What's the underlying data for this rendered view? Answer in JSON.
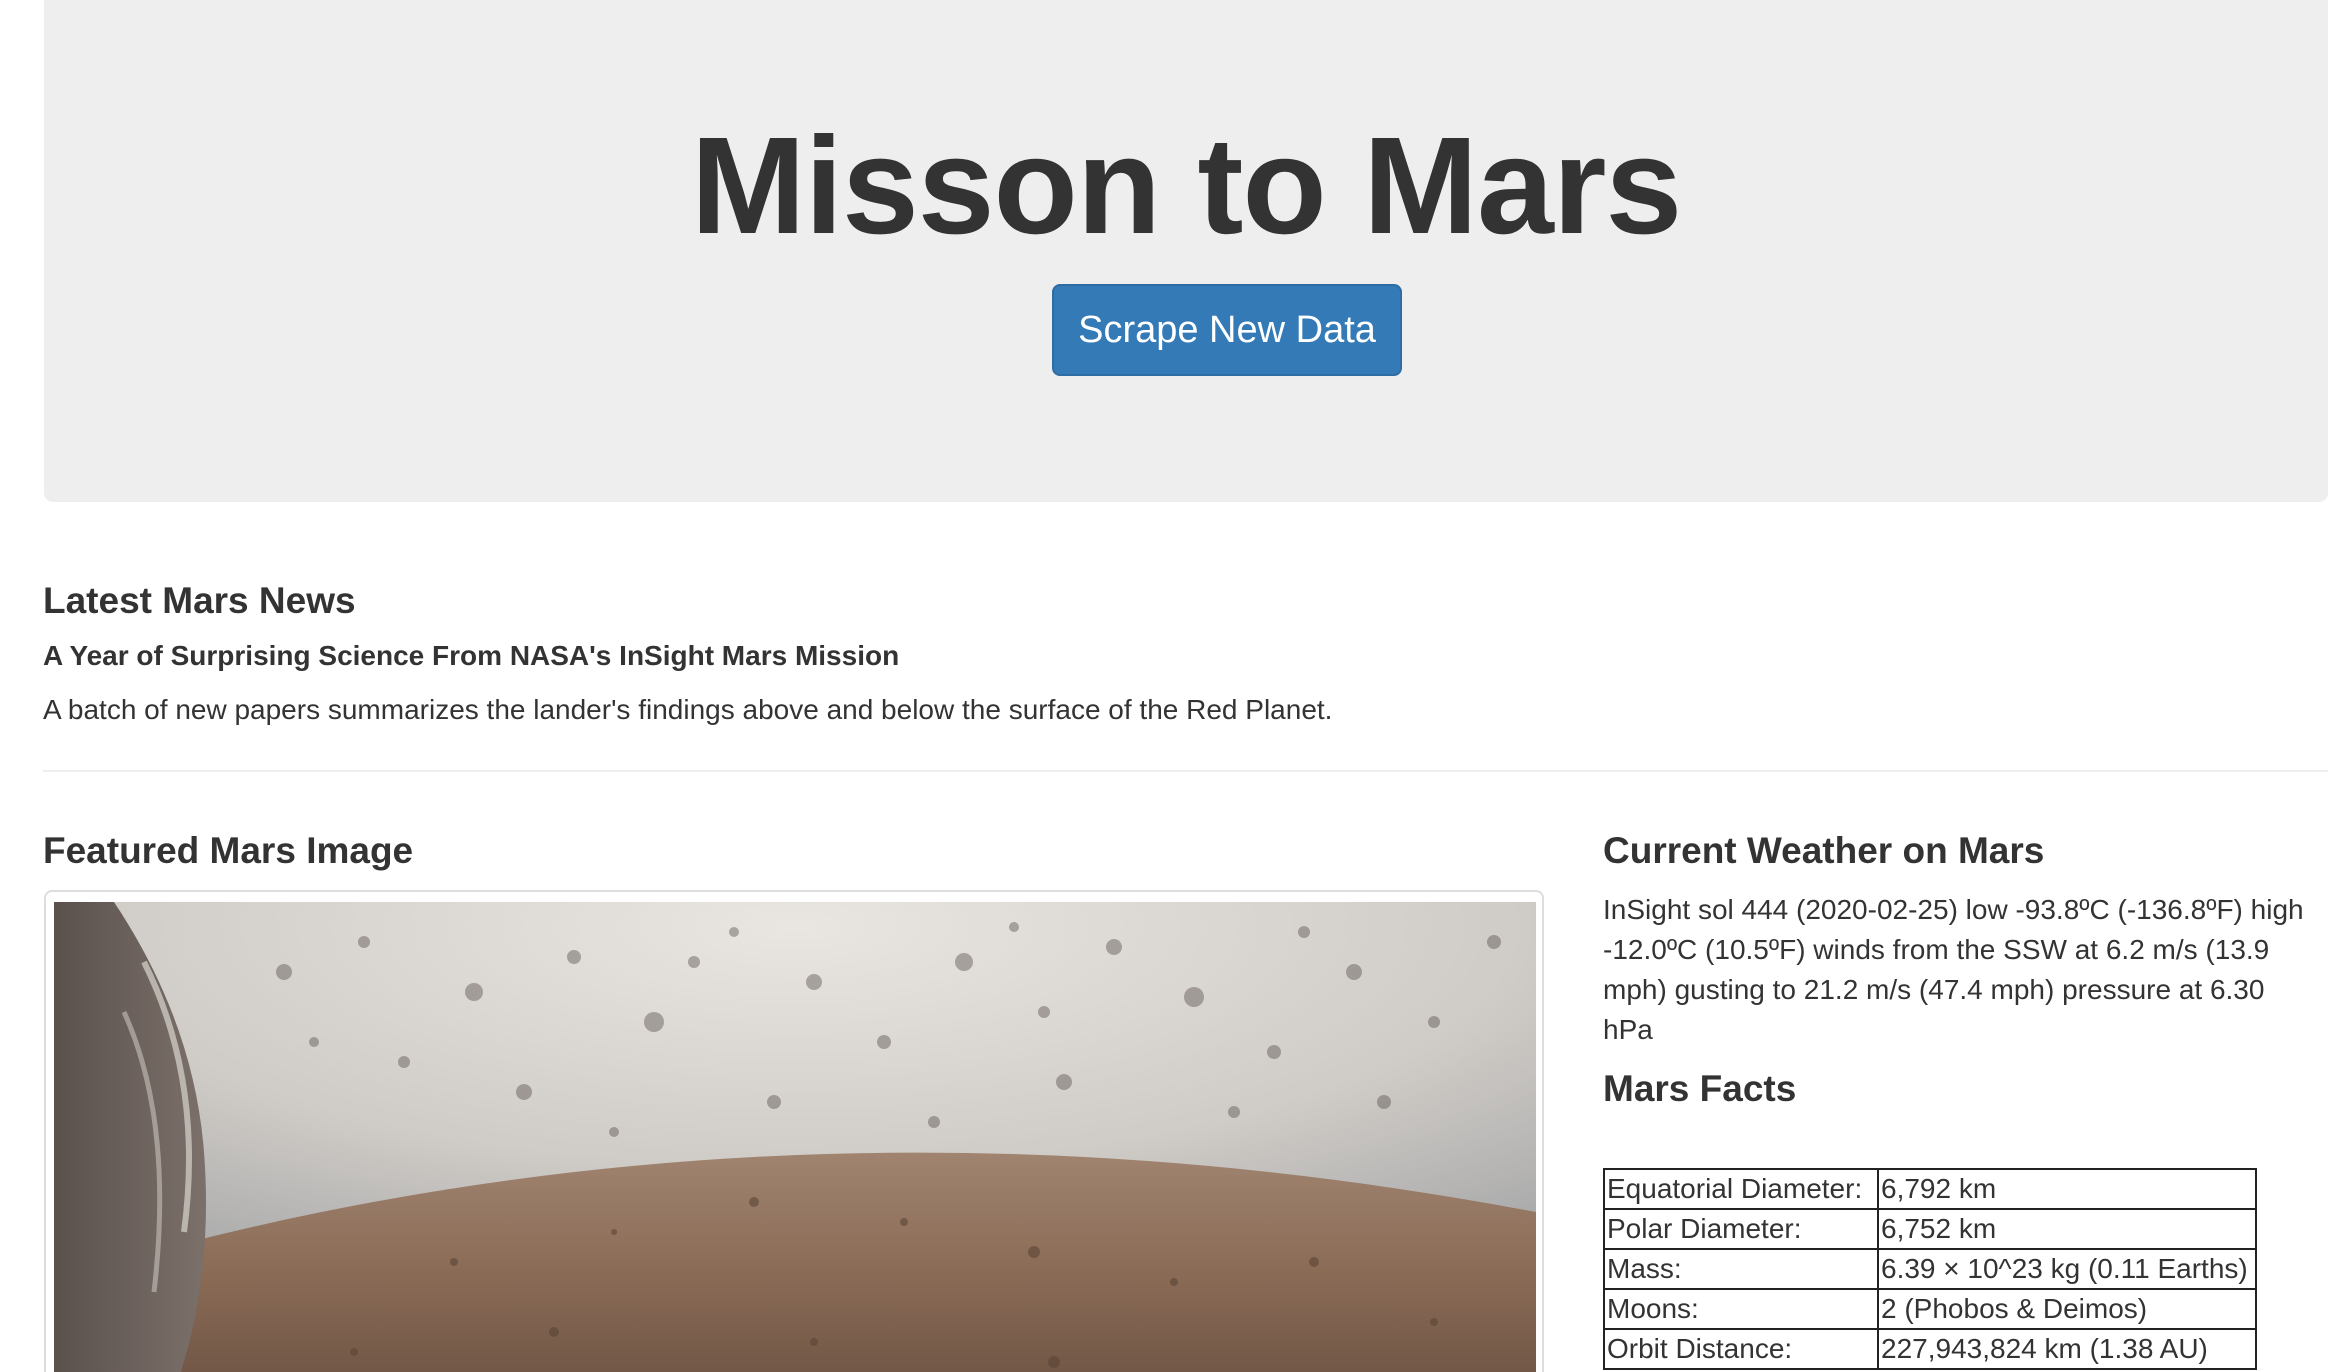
{
  "header": {
    "title": "Misson to Mars",
    "scrape_button_label": "Scrape New Data"
  },
  "news": {
    "heading": "Latest Mars News",
    "title": "A Year of Surprising Science From NASA's InSight Mars Mission",
    "teaser": "A batch of new papers summarizes the lander's findings above and below the surface of the Red Planet."
  },
  "featured_image": {
    "heading": "Featured Mars Image"
  },
  "weather": {
    "heading": "Current Weather on Mars",
    "text": "InSight sol 444 (2020-02-25) low -93.8ºC (-136.8ºF) high -12.0ºC (10.5ºF) winds from the SSW at 6.2 m/s (13.9 mph) gusting to 21.2 m/s (47.4 mph) pressure at 6.30 hPa"
  },
  "facts": {
    "heading": "Mars Facts",
    "rows": [
      {
        "label": "Equatorial Diameter:",
        "value": "6,792 km"
      },
      {
        "label": "Polar Diameter:",
        "value": "6,752 km"
      },
      {
        "label": "Mass:",
        "value": "6.39 × 10^23 kg (0.11 Earths)"
      },
      {
        "label": "Moons:",
        "value": "2 (Phobos & Deimos)"
      },
      {
        "label": "Orbit Distance:",
        "value": "227,943,824 km (1.38 AU)"
      }
    ]
  },
  "colors": {
    "jumbotron_bg": "#eeeeee",
    "button_bg": "#337ab7",
    "text": "#333333"
  }
}
